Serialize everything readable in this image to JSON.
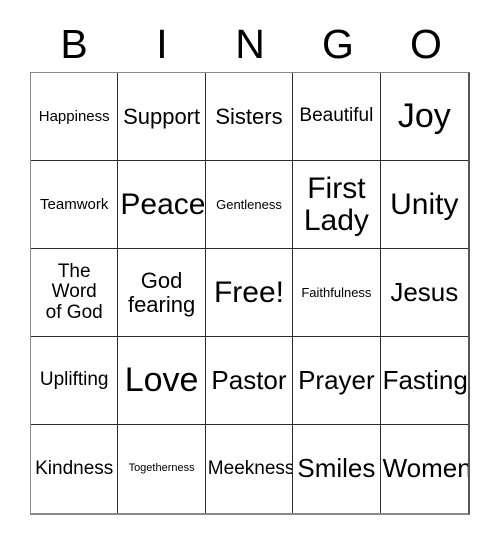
{
  "header": {
    "letters": [
      "B",
      "I",
      "N",
      "G",
      "O"
    ]
  },
  "grid": {
    "columns": 5,
    "rows": 5,
    "cells": [
      {
        "text": "Happiness",
        "size": "xs"
      },
      {
        "text": "Support",
        "size": "md"
      },
      {
        "text": "Sisters",
        "size": "md"
      },
      {
        "text": "Beautiful",
        "size": "sm"
      },
      {
        "text": "Joy",
        "size": "xxl"
      },
      {
        "text": "Teamwork",
        "size": "xs"
      },
      {
        "text": "Peace",
        "size": "xl"
      },
      {
        "text": "Gentleness",
        "size": "xxs"
      },
      {
        "text": "First\nLady",
        "size": "xl"
      },
      {
        "text": "Unity",
        "size": "xl"
      },
      {
        "text": "The\nWord\nof God",
        "size": "sm"
      },
      {
        "text": "God\nfearing",
        "size": "md"
      },
      {
        "text": "Free!",
        "size": "xl"
      },
      {
        "text": "Faithfulness",
        "size": "xxs"
      },
      {
        "text": "Jesus",
        "size": "lg"
      },
      {
        "text": "Uplifting",
        "size": "sm"
      },
      {
        "text": "Love",
        "size": "xxl"
      },
      {
        "text": "Pastor",
        "size": "lg"
      },
      {
        "text": "Prayer",
        "size": "lg"
      },
      {
        "text": "Fasting",
        "size": "lg"
      },
      {
        "text": "Kindness",
        "size": "sm"
      },
      {
        "text": "Togetherness",
        "size": "tiny"
      },
      {
        "text": "Meekness",
        "size": "sm"
      },
      {
        "text": "Smiles",
        "size": "lg"
      },
      {
        "text": "Women",
        "size": "lg"
      }
    ]
  },
  "colors": {
    "background": "#ffffff",
    "text": "#000000",
    "grid_line": "#2b2b2b",
    "grid_outer": "#8a8a8a"
  }
}
